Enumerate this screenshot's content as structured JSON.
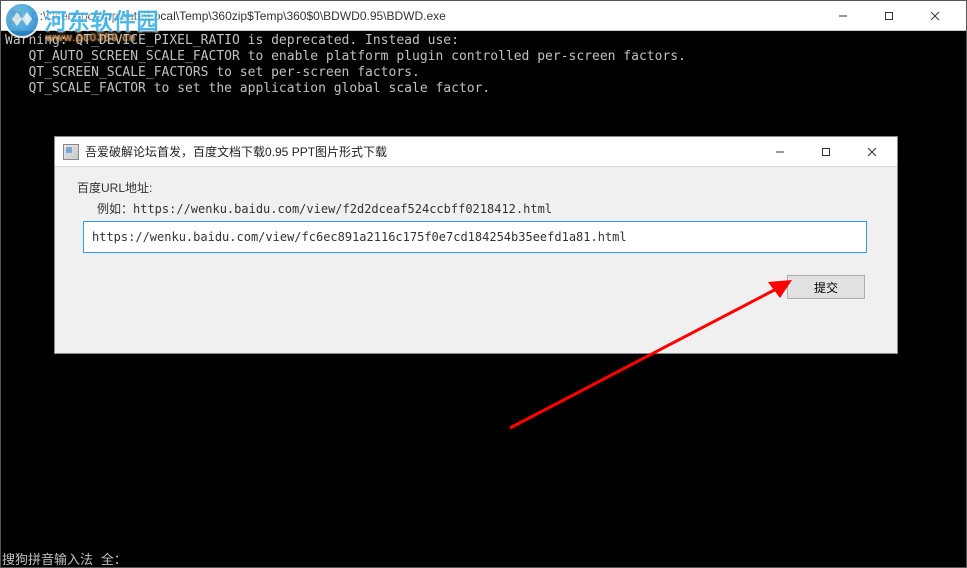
{
  "console": {
    "title": "C:\\Users\\pc\\AppData\\Local\\Temp\\360zip$Temp\\360$0\\BDWD0.95\\BDWD.exe",
    "lines": [
      "Warning: QT_DEVICE_PIXEL_RATIO is deprecated. Instead use:",
      "   QT_AUTO_SCREEN_SCALE_FACTOR to enable platform plugin controlled per-screen factors.",
      "   QT_SCREEN_SCALE_FACTORS to set per-screen factors.",
      "   QT_SCALE_FACTOR to set the application global scale factor."
    ]
  },
  "logo": {
    "text": "河东软件园",
    "sub": "www.pc0359.cn"
  },
  "dialog": {
    "title": "吾爱破解论坛首发，百度文档下载0.95 PPT图片形式下载",
    "label": "百度URL地址:",
    "hint": "例如：https://wenku.baidu.com/view/f2d2dceaf524ccbff0218412.html",
    "input_value": "https://wenku.baidu.com/view/fc6ec891a2116c175f0e7cd184254b35eefd1a81.html",
    "submit": "提交"
  },
  "ime": "搜狗拼音输入法 全："
}
